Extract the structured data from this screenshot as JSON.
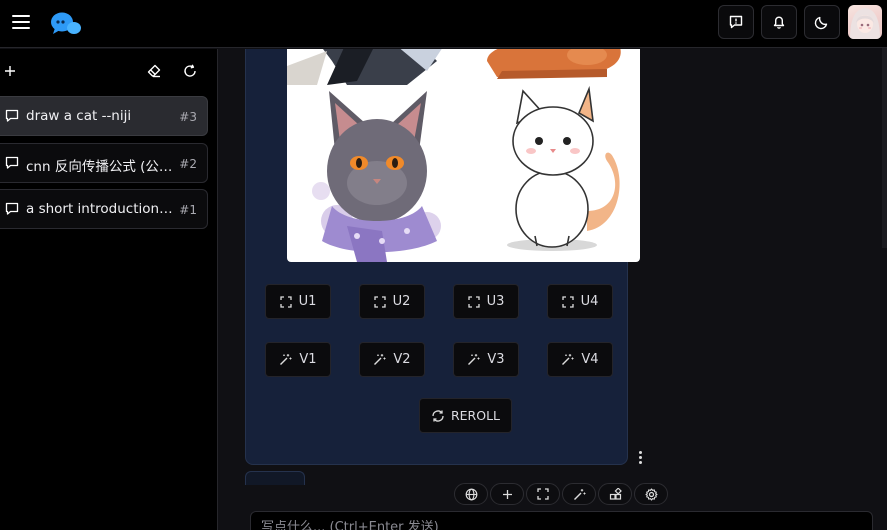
{
  "sidebar": {
    "conversations": [
      {
        "title": "draw a cat --niji",
        "index": "#3"
      },
      {
        "title": "cnn 反向传播公式 (公式表示)",
        "index": "#2"
      },
      {
        "title": "a short introduction of AI",
        "index": "#1"
      }
    ]
  },
  "message": {
    "upscale_buttons": [
      "U1",
      "U2",
      "U3",
      "U4"
    ],
    "variation_buttons": [
      "V1",
      "V2",
      "V3",
      "V4"
    ],
    "reroll_label": "REROLL"
  },
  "composer": {
    "placeholder": "写点什么... (Ctrl+Enter 发送)"
  },
  "colors": {
    "accent": "#2e9af7",
    "bubble": "#16213a",
    "active_item": "#2a2b30"
  }
}
